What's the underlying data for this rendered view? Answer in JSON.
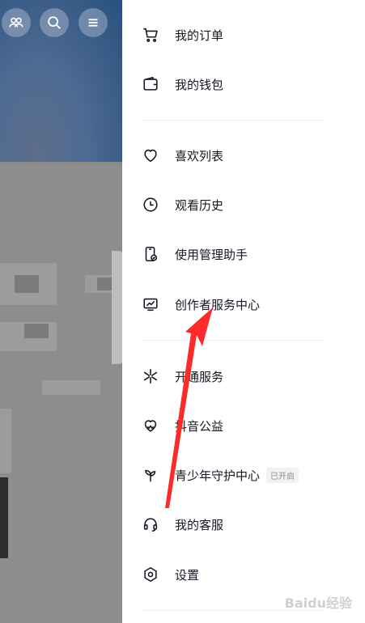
{
  "background": {
    "accent_color": "#ff2a2a"
  },
  "top_icons": [
    {
      "icon": "friends-icon"
    },
    {
      "icon": "search-icon"
    },
    {
      "icon": "menu-icon"
    }
  ],
  "drawer": {
    "group1": [
      {
        "label": "我的订单",
        "icon": "cart-icon"
      },
      {
        "label": "我的钱包",
        "icon": "wallet-icon"
      }
    ],
    "group2": [
      {
        "label": "喜欢列表",
        "icon": "heart-icon"
      },
      {
        "label": "观看历史",
        "icon": "clock-icon"
      },
      {
        "label": "使用管理助手",
        "icon": "phone-check-icon"
      },
      {
        "label": "创作者服务中心",
        "icon": "creator-chart-icon"
      }
    ],
    "group3": [
      {
        "label": "开通服务",
        "icon": "sparkle-icon"
      },
      {
        "label": "抖音公益",
        "icon": "charity-heart-icon"
      },
      {
        "label": "青少年守护中心",
        "icon": "sprout-icon",
        "badge": "已开启"
      },
      {
        "label": "我的客服",
        "icon": "headset-icon"
      },
      {
        "label": "设置",
        "icon": "settings-icon"
      }
    ]
  },
  "watermark": "Baidu经验"
}
